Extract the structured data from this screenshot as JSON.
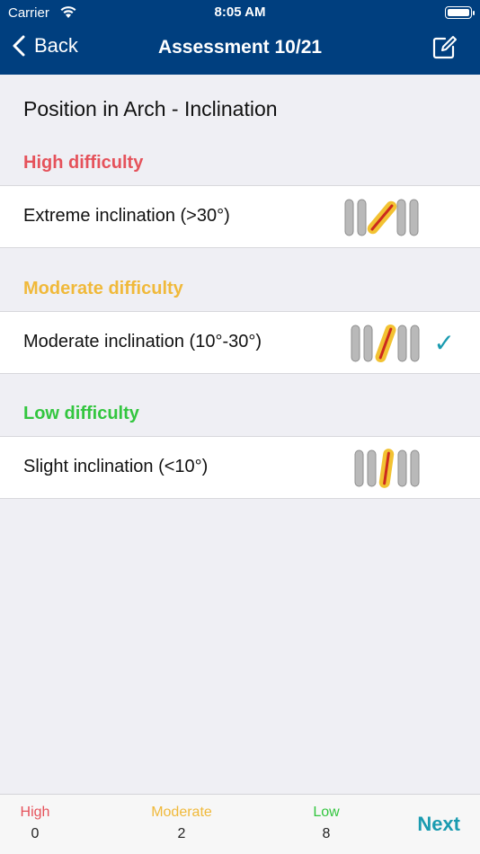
{
  "status_bar": {
    "carrier": "Carrier",
    "time": "8:05 AM"
  },
  "nav": {
    "back_label": "Back",
    "title": "Assessment 10/21",
    "icons": {
      "back": "chevron-left-icon",
      "edit": "compose-icon"
    }
  },
  "page_title": "Position in Arch - Inclination",
  "sections": [
    {
      "header": "High difficulty",
      "color": "#e5525b",
      "option": {
        "label": "Extreme inclination (>30°)",
        "selected": false
      }
    },
    {
      "header": "Moderate difficulty",
      "color": "#f0b93a",
      "option": {
        "label": "Moderate inclination (10°-30°)",
        "selected": true
      }
    },
    {
      "header": "Low difficulty",
      "color": "#33c63f",
      "option": {
        "label": "Slight inclination (<10°)",
        "selected": false
      }
    }
  ],
  "check_mark": "✓",
  "footer": {
    "high": {
      "label": "High",
      "value": "0",
      "color": "#e5525b"
    },
    "moderate": {
      "label": "Moderate",
      "value": "2",
      "color": "#f0b93a"
    },
    "low": {
      "label": "Low",
      "value": "8",
      "color": "#33c63f"
    },
    "next_label": "Next"
  },
  "accent_color": "#1a9bb0",
  "bar_color": "#003f7f"
}
